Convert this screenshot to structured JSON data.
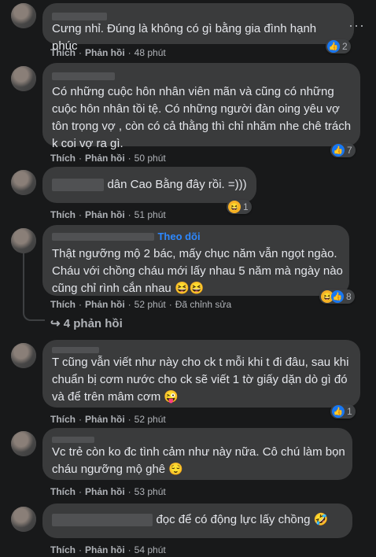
{
  "labels": {
    "like": "Thích",
    "reply": "Phản hồi",
    "follow": "Theo dõi",
    "edited": "Đã chỉnh sửa"
  },
  "comments": [
    {
      "text": "Cưng nhỉ. Đúng là không có gì bằng gia đình hạnh phúc",
      "time": "48 phút",
      "reaction_count": "2",
      "reactions": [
        "like-icon"
      ]
    },
    {
      "text": "Có những cuộc hôn nhân viên mãn và cũng có những cuộc hôn nhân tồi tệ. Có những người đàn oing yêu vợ tôn trọng vợ , còn có cả thằng thì chỉ nhăm nhe chê trách k coi vợ ra gì.",
      "time": "50 phút",
      "reaction_count": "7",
      "reactions": [
        "like-icon"
      ]
    },
    {
      "text": "dân Cao Bằng đây rồi. =)))",
      "time": "51 phút",
      "reaction_count": "1",
      "reactions": [
        "haha-icon"
      ]
    },
    {
      "text": "Thật ngưỡng mộ 2 bác, mấy chục năm vẫn ngọt ngào. Cháu với chồng cháu mới lấy nhau 5 năm mà ngày nào cũng chỉ rình cắn nhau 😆😆",
      "time": "52 phút",
      "reaction_count": "8",
      "reactions": [
        "haha-icon",
        "like-icon"
      ],
      "replies": "4 phản hồi"
    },
    {
      "text": "T cũng vẫn viết như này cho ck t mỗi khi t đi đâu, sau khi chuẩn bị cơm nước cho ck sẽ viết 1 tờ giấy dặn dò gì đó và để trên mâm cơm 😜",
      "time": "52 phút",
      "reaction_count": "1",
      "reactions": [
        "like-icon"
      ]
    },
    {
      "text": "Vc trẻ còn ko đc tình cảm như này nữa. Cô chú làm bọn cháu ngưỡng mộ ghê 😌",
      "time": "53 phút"
    },
    {
      "text": "đọc để có động lực lấy chồng 🤣",
      "time": "54 phút"
    }
  ]
}
